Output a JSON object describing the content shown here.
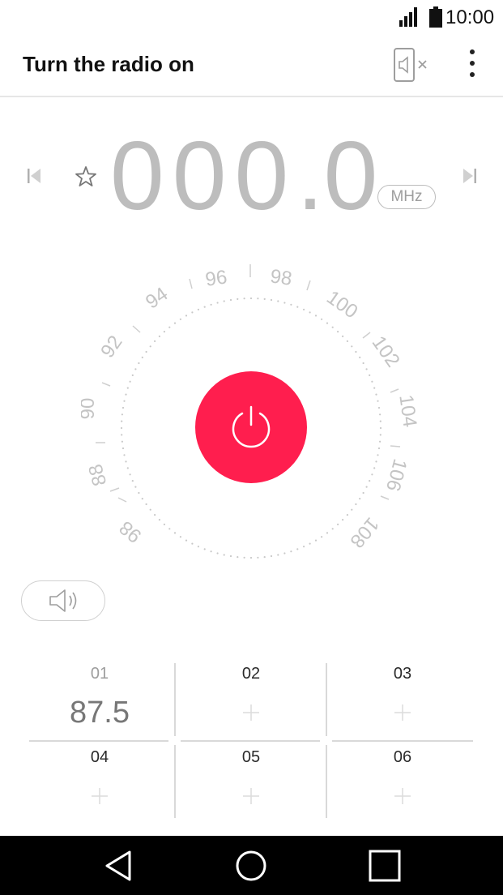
{
  "status_bar": {
    "time": "10:00",
    "icons": [
      "signal-icon",
      "battery-icon"
    ]
  },
  "app_bar": {
    "title": "Turn the radio on",
    "icons": [
      "speaker-mute-icon",
      "more-vert-icon"
    ]
  },
  "tuner": {
    "frequency_whole": "000",
    "frequency_decimal": "0",
    "unit": "MHz",
    "icons": [
      "skip-previous-icon",
      "star-icon",
      "skip-next-icon"
    ]
  },
  "dial": {
    "labels": [
      "96",
      "98",
      "100",
      "102",
      "104",
      "106",
      "108",
      "98",
      "88",
      "90",
      "92",
      "94"
    ],
    "power_icon": "power-icon"
  },
  "speaker": {
    "icon": "speaker-icon"
  },
  "presets": [
    {
      "number": "01",
      "frequency": "87.5"
    },
    {
      "number": "02",
      "frequency": ""
    },
    {
      "number": "03",
      "frequency": ""
    },
    {
      "number": "04",
      "frequency": ""
    },
    {
      "number": "05",
      "frequency": ""
    },
    {
      "number": "06",
      "frequency": ""
    }
  ],
  "nav_bar": {
    "icons": [
      "back-icon",
      "home-icon",
      "recents-icon"
    ]
  },
  "colors": {
    "accent": "#ff1e4e",
    "digits": "#bdbdbd",
    "text_primary": "#111111",
    "text_secondary": "#9e9e9e"
  }
}
